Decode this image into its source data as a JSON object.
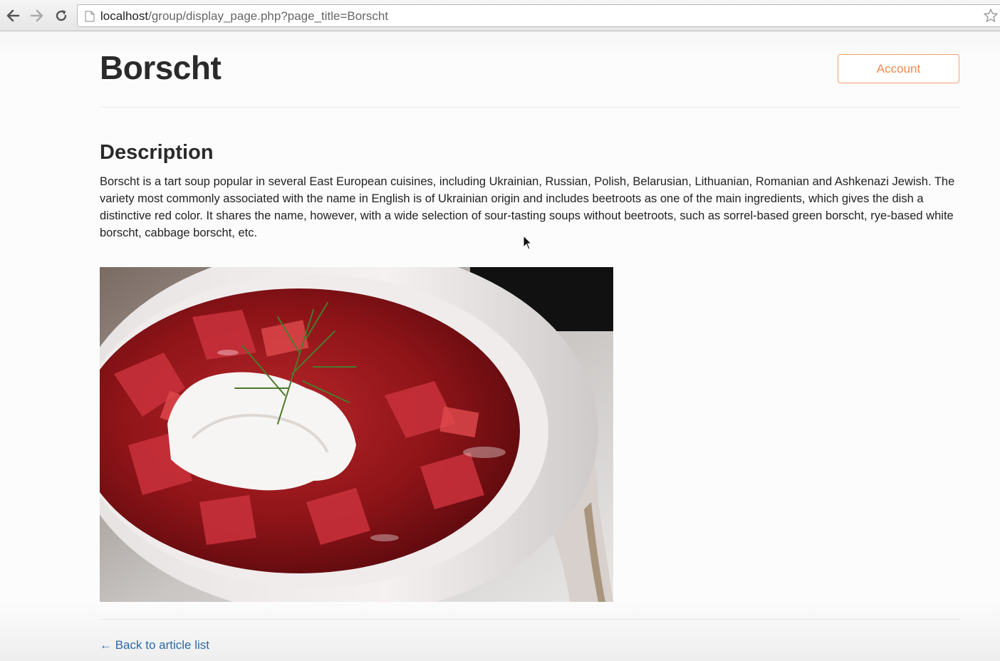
{
  "browser": {
    "url_host": "localhost",
    "url_path": "/group/display_page.php?page_title=Borscht"
  },
  "header": {
    "title": "Borscht",
    "account_label": "Account"
  },
  "article": {
    "section_heading": "Description",
    "description": "Borscht is a tart soup popular in several East European cuisines, including Ukrainian, Russian, Polish, Belarusian, Lithuanian, Romanian and Ashkenazi Jewish. The variety most commonly associated with the name in English is of Ukrainian origin and includes beetroots as one of the main ingredients, which gives the dish a distinctive red color. It shares the name, however, with a wide selection of sour-tasting soups without beetroots, such as sorrel-based green borscht, rye-based white borscht, cabbage borscht, etc."
  },
  "footer": {
    "back_link": "← Back to article list"
  },
  "colors": {
    "accent_orange": "#f08a4b",
    "link_blue": "#2a6aa8"
  }
}
